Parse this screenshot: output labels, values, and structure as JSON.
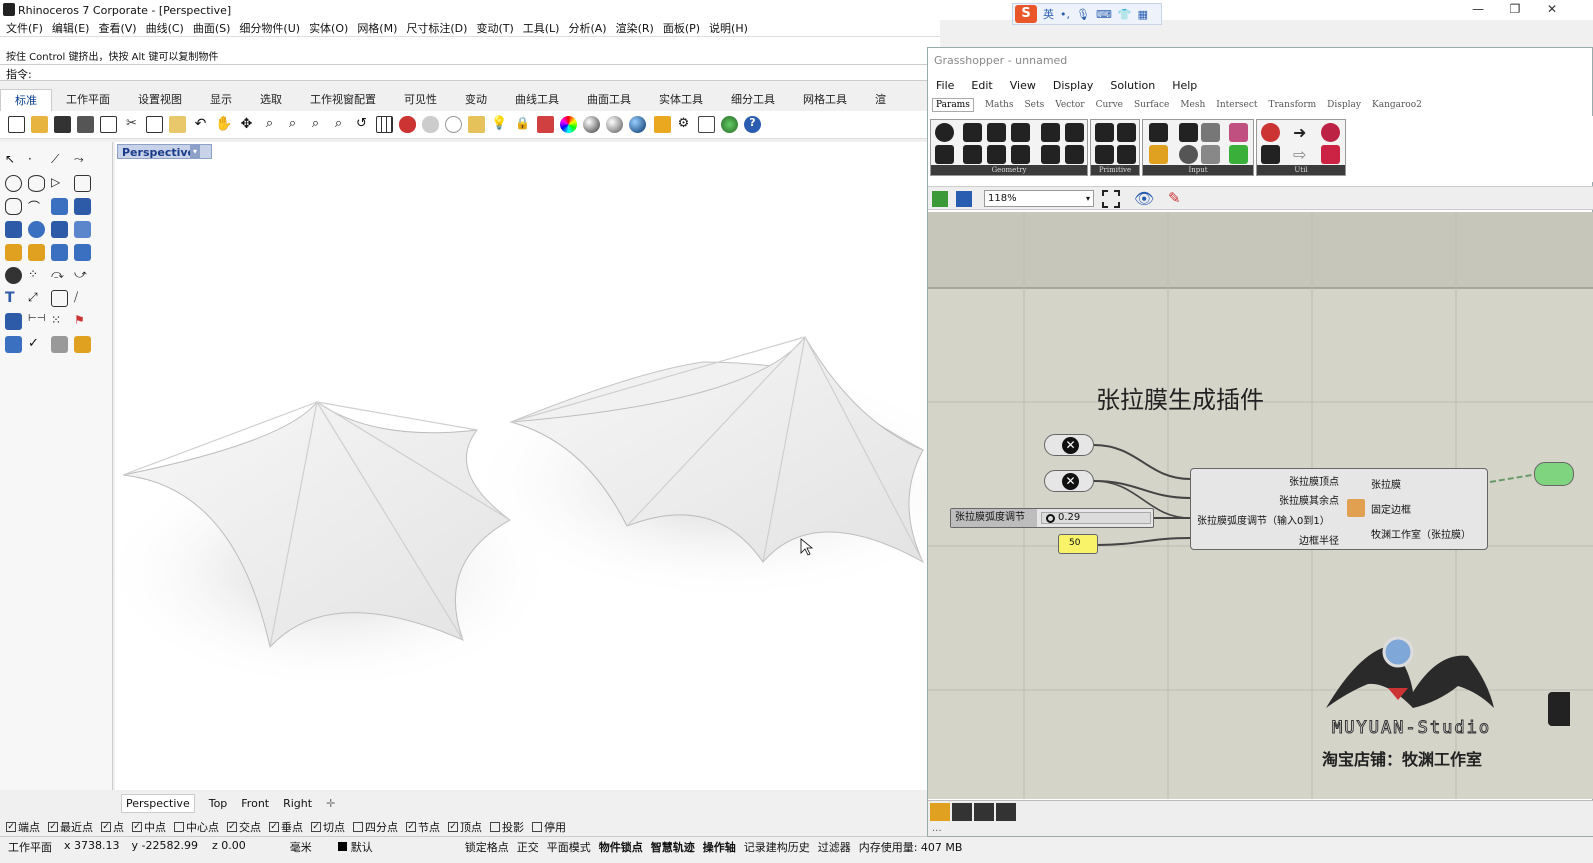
{
  "rhino": {
    "title": "Rhinoceros 7 Corporate - [Perspective]",
    "menu": [
      "文件(F)",
      "编辑(E)",
      "查看(V)",
      "曲线(C)",
      "曲面(S)",
      "细分物件(U)",
      "实体(O)",
      "网格(M)",
      "尺寸标注(D)",
      "变动(T)",
      "工具(L)",
      "分析(A)",
      "渲染(R)",
      "面板(P)",
      "说明(H)"
    ],
    "cmd_history": [
      "按住 Control 键挤出，快按 Alt 键可以复制物件"
    ],
    "cmd_prompt": "指令:",
    "tabs": [
      "标准",
      "工作平面",
      "设置视图",
      "显示",
      "选取",
      "工作视窗配置",
      "可见性",
      "变动",
      "曲线工具",
      "曲面工具",
      "实体工具",
      "细分工具",
      "网格工具",
      "渲"
    ],
    "viewport_label": "Perspective",
    "view_tabs": [
      "Perspective",
      "Top",
      "Front",
      "Right"
    ],
    "osnaps": [
      {
        "label": "端点",
        "checked": true
      },
      {
        "label": "最近点",
        "checked": true
      },
      {
        "label": "点",
        "checked": true
      },
      {
        "label": "中点",
        "checked": true
      },
      {
        "label": "中心点",
        "checked": false
      },
      {
        "label": "交点",
        "checked": true
      },
      {
        "label": "垂点",
        "checked": true
      },
      {
        "label": "切点",
        "checked": true
      },
      {
        "label": "四分点",
        "checked": false
      },
      {
        "label": "节点",
        "checked": true
      },
      {
        "label": "顶点",
        "checked": true
      },
      {
        "label": "投影",
        "checked": false
      },
      {
        "label": "停用",
        "checked": false
      }
    ],
    "status": {
      "cplane": "工作平面",
      "x": "x 3738.13",
      "y": "y -22582.99",
      "z": "z 0.00",
      "units": "毫米",
      "layer": "默认",
      "toggles": [
        "锁定格点",
        "正交",
        "平面模式",
        "物件锁点",
        "智慧轨迹",
        "操作轴",
        "记录建构历史",
        "过滤器"
      ],
      "memory": "内存使用量: 407 MB"
    }
  },
  "ime": {
    "lang": "英"
  },
  "grasshopper": {
    "title": "Grasshopper - unnamed",
    "menu": [
      "File",
      "Edit",
      "View",
      "Display",
      "Solution",
      "Help"
    ],
    "tabs": [
      "Params",
      "Maths",
      "Sets",
      "Vector",
      "Curve",
      "Surface",
      "Mesh",
      "Intersect",
      "Transform",
      "Display",
      "Kangaroo2"
    ],
    "groups": [
      "Geometry",
      "Primitive",
      "Input",
      "Util"
    ],
    "zoom": "118%",
    "canvas_title": "张拉膜生成插件",
    "slider_label": "张拉膜弧度调节",
    "slider_value": "0.29",
    "panel_value": "50",
    "component": {
      "inputs": [
        "张拉膜顶点",
        "张拉膜其余点",
        "张拉膜弧度调节（输入0到1）",
        "边框半径"
      ],
      "outputs": [
        "张拉膜",
        "固定边框",
        "牧渊工作室（张拉膜）"
      ]
    },
    "logo_text": "MUYUAN-Studio",
    "shop_text": "淘宝店铺：牧渊工作室"
  }
}
